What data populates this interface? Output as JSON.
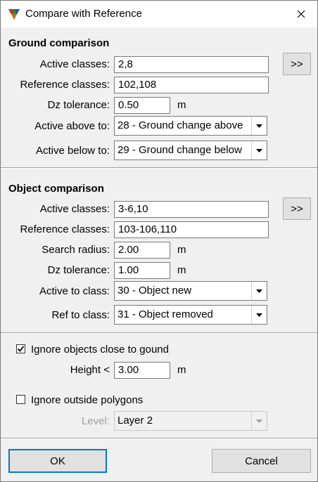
{
  "window": {
    "title": "Compare with Reference"
  },
  "ground": {
    "section_title": "Ground comparison",
    "active_classes_label": "Active classes:",
    "active_classes_value": "2,8",
    "reference_classes_label": "Reference classes:",
    "reference_classes_value": "102,108",
    "dz_tolerance_label": "Dz tolerance:",
    "dz_tolerance_value": "0.50",
    "dz_unit": "m",
    "active_above_label": "Active above to:",
    "active_above_value": "28 - Ground change above",
    "active_below_label": "Active below to:",
    "active_below_value": "29 - Ground change below",
    "browse_label": ">>"
  },
  "object": {
    "section_title": "Object comparison",
    "active_classes_label": "Active classes:",
    "active_classes_value": "3-6,10",
    "reference_classes_label": "Reference classes:",
    "reference_classes_value": "103-106,110",
    "search_radius_label": "Search radius:",
    "search_radius_value": "2.00",
    "search_radius_unit": "m",
    "dz_tolerance_label": "Dz tolerance:",
    "dz_tolerance_value": "1.00",
    "dz_unit": "m",
    "active_to_class_label": "Active to class:",
    "active_to_class_value": "30 - Object new",
    "ref_to_class_label": "Ref to class:",
    "ref_to_class_value": "31 - Object removed",
    "browse_label": ">>"
  },
  "options": {
    "ignore_close_label": "Ignore objects close to gound",
    "ignore_close_checked": true,
    "height_label": "Height <",
    "height_value": "3.00",
    "height_unit": "m",
    "ignore_outside_label": "Ignore outside polygons",
    "ignore_outside_checked": false,
    "level_label": "Level:",
    "level_value": "Layer 2"
  },
  "buttons": {
    "ok": "OK",
    "cancel": "Cancel"
  }
}
